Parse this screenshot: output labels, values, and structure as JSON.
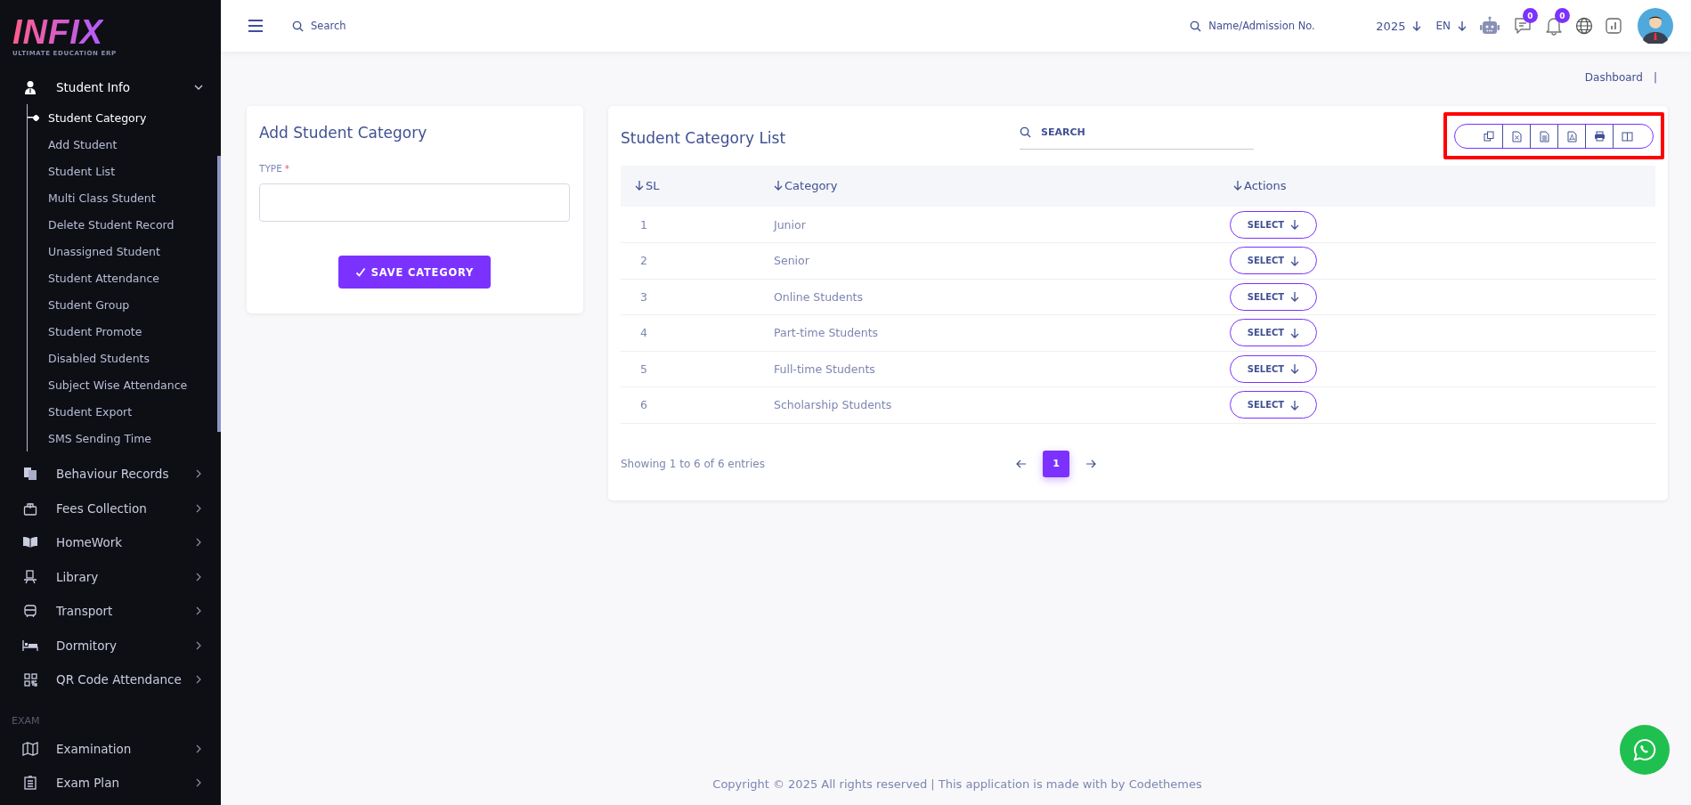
{
  "logo": {
    "text": "INFIX",
    "tagline": "ULTIMATE EDUCATION ERP"
  },
  "sidebar": {
    "items": [
      {
        "kind": "group",
        "label": "Student Info",
        "expanded": true,
        "children": [
          {
            "label": "Student Category",
            "selected": true
          },
          {
            "label": "Add Student",
            "selected": false
          },
          {
            "label": "Student List",
            "selected": false
          },
          {
            "label": "Multi Class Student",
            "selected": false
          },
          {
            "label": "Delete Student Record",
            "selected": false
          },
          {
            "label": "Unassigned Student",
            "selected": false
          },
          {
            "label": "Student Attendance",
            "selected": false
          },
          {
            "label": "Student Group",
            "selected": false
          },
          {
            "label": "Student Promote",
            "selected": false
          },
          {
            "label": "Disabled Students",
            "selected": false
          },
          {
            "label": "Subject Wise Attendance",
            "selected": false
          },
          {
            "label": "Student Export",
            "selected": false
          },
          {
            "label": "SMS Sending Time",
            "selected": false
          }
        ]
      },
      {
        "kind": "group",
        "label": "Behaviour Records",
        "expanded": false
      },
      {
        "kind": "group",
        "label": "Fees Collection",
        "expanded": false
      },
      {
        "kind": "group",
        "label": "HomeWork",
        "expanded": false
      },
      {
        "kind": "group",
        "label": "Library",
        "expanded": false
      },
      {
        "kind": "group",
        "label": "Transport",
        "expanded": false
      },
      {
        "kind": "group",
        "label": "Dormitory",
        "expanded": false
      },
      {
        "kind": "group",
        "label": "QR Code Attendance",
        "expanded": false
      },
      {
        "kind": "heading",
        "label": "EXAM"
      },
      {
        "kind": "group",
        "label": "Examination",
        "expanded": false
      },
      {
        "kind": "group",
        "label": "Exam Plan",
        "expanded": false
      }
    ]
  },
  "header": {
    "search_placeholder": "Search",
    "student_search_placeholder": "Name/Admission No.",
    "year": "2025",
    "language": "EN",
    "chat_badge": "0",
    "notification_badge": "0"
  },
  "breadcrumb": {
    "items": [
      "Dashboard"
    ],
    "separator": "|"
  },
  "form": {
    "title": "Add Student Category",
    "field_label": "TYPE",
    "required_mark": "*",
    "button": "SAVE CATEGORY"
  },
  "list": {
    "title": "Student Category List",
    "search_placeholder": "SEARCH",
    "columns": [
      "SL",
      "Category",
      "Actions"
    ],
    "rows": [
      {
        "sl": "1",
        "category": "Junior",
        "action": "SELECT"
      },
      {
        "sl": "2",
        "category": "Senior",
        "action": "SELECT"
      },
      {
        "sl": "3",
        "category": "Online Students",
        "action": "SELECT"
      },
      {
        "sl": "4",
        "category": "Part-time Students",
        "action": "SELECT"
      },
      {
        "sl": "5",
        "category": "Full-time Students",
        "action": "SELECT"
      },
      {
        "sl": "6",
        "category": "Scholarship Students",
        "action": "SELECT"
      }
    ],
    "info": "Showing 1 to 6 of 6 entries",
    "pages": [
      {
        "label": "1",
        "selected": true
      }
    ]
  },
  "footer": {
    "text": "Copyright © 2025 All rights reserved | This application is made with by Codethemes"
  }
}
